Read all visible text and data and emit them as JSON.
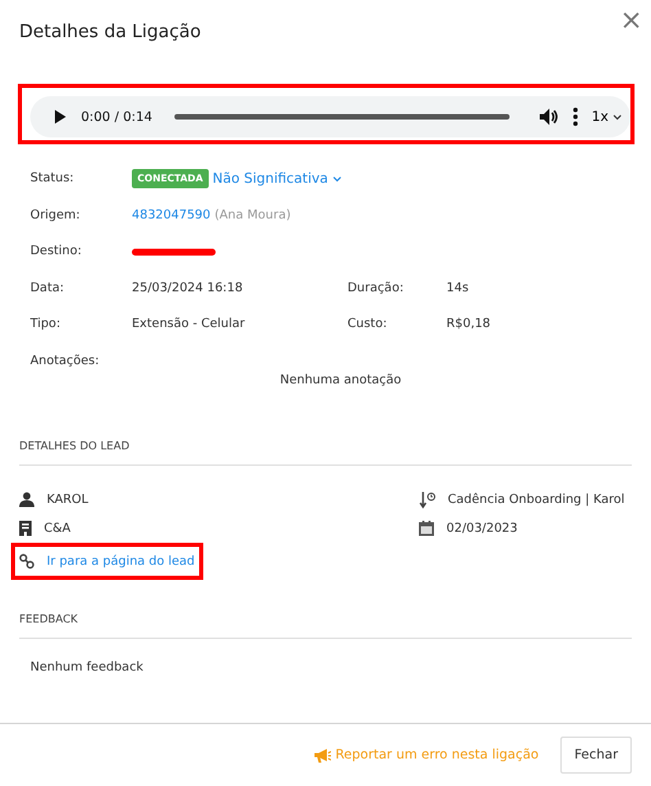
{
  "window": {
    "title": "Detalhes da Ligação",
    "close": "×"
  },
  "player": {
    "time": "0:00 / 0:14",
    "speed": "1x"
  },
  "status": {
    "label": "Status:",
    "badge": "CONECTADA",
    "value": "Não Significativa"
  },
  "origin": {
    "label": "Origem:",
    "number": "4832047590",
    "name": "(Ana Moura)"
  },
  "destination": {
    "label": "Destino:"
  },
  "details": [
    {
      "label": "Data:",
      "value": "25/03/2024 16:18",
      "label_2": "Duração:",
      "value_2": "14s"
    },
    {
      "label": "Tipo:",
      "value": "Extensão - Celular",
      "label_2": "Custo:",
      "value_2": "R$0,18"
    }
  ],
  "notes": {
    "label": "Anotações:",
    "empty": "Nenhuma anotação"
  },
  "lead": {
    "heading": "DETALHES DO LEAD",
    "name": "KAROL",
    "company": "C&A",
    "link": "Ir para a página do lead",
    "cadence": "Cadência Onboarding | Karol",
    "date": "02/03/2023"
  },
  "feedback": {
    "heading": "FEEDBACK",
    "empty": "Nenhum feedback"
  },
  "footer": {
    "report": "Reportar um erro nesta ligação",
    "close": "Fechar"
  }
}
